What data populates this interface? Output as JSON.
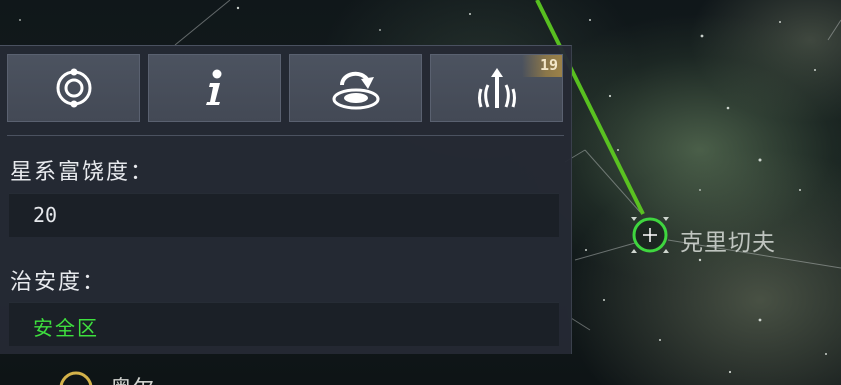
{
  "buttons": [
    {
      "icon": "orbit-icon"
    },
    {
      "icon": "info-icon"
    },
    {
      "icon": "landing-icon"
    },
    {
      "icon": "signal-tower-icon",
      "badge": "19"
    }
  ],
  "stats": {
    "richness_label": "星系富饶度：",
    "richness_value": "20",
    "security_label": "治安度：",
    "security_value": "安全区"
  },
  "map": {
    "selected_system": "克里切夫",
    "partial_system": "奥尔"
  },
  "colors": {
    "security_safe": "#3ee03e",
    "route_line": "#5fd020",
    "badge_bg": "#9c8448",
    "panel_bg": "#252a34"
  }
}
